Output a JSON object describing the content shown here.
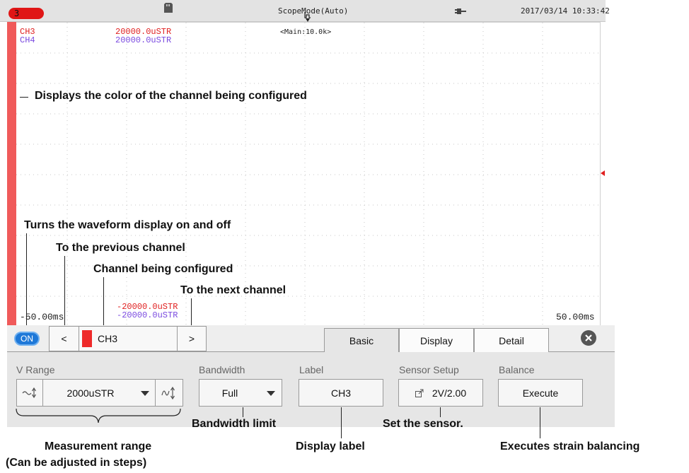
{
  "status_bar": {
    "channel_badge": "3",
    "mode": "ScopeMode(Auto)",
    "datetime": "2017/03/14 10:33:42"
  },
  "waveform": {
    "main_info": "<Main:10.0k>",
    "channels": [
      {
        "name": "CH3",
        "scale": "20000.0uSTR",
        "color": "#e02020"
      },
      {
        "name": "CH4",
        "scale": "20000.0uSTR",
        "color": "#7a4ae0"
      }
    ],
    "bottom_values": [
      "-20000.0uSTR",
      "-20000.0uSTR"
    ],
    "time_left": "-50.00ms",
    "time_right": "50.00ms"
  },
  "callouts": {
    "color": "Displays the color of the channel being configured",
    "display_toggle": "Turns the waveform display on and off",
    "prev_channel": "To the previous channel",
    "current_channel": "Channel being configured",
    "next_channel": "To the next channel",
    "bandwidth": "Bandwidth limit",
    "sensor": "Set the sensor.",
    "range_line1": "Measurement range",
    "range_line2": "(Can be adjusted in steps)",
    "label": "Display label",
    "balance": "Executes strain balancing"
  },
  "panel": {
    "on_label": "ON",
    "prev_symbol": "<",
    "current_channel": "CH3",
    "next_symbol": ">",
    "tabs": [
      "Basic",
      "Display",
      "Detail"
    ],
    "active_tab": "Basic",
    "vrange_label": "V Range",
    "vrange_value": "2000uSTR",
    "bandwidth_label": "Bandwidth",
    "bandwidth_value": "Full",
    "label_label": "Label",
    "label_value": "CH3",
    "sensor_label": "Sensor Setup",
    "sensor_value": "2V/2.00",
    "balance_label": "Balance",
    "balance_value": "Execute"
  },
  "colors": {
    "channel_color": "#f05a5a",
    "badge": "#e01616",
    "on_pill": "#1e78d8"
  }
}
